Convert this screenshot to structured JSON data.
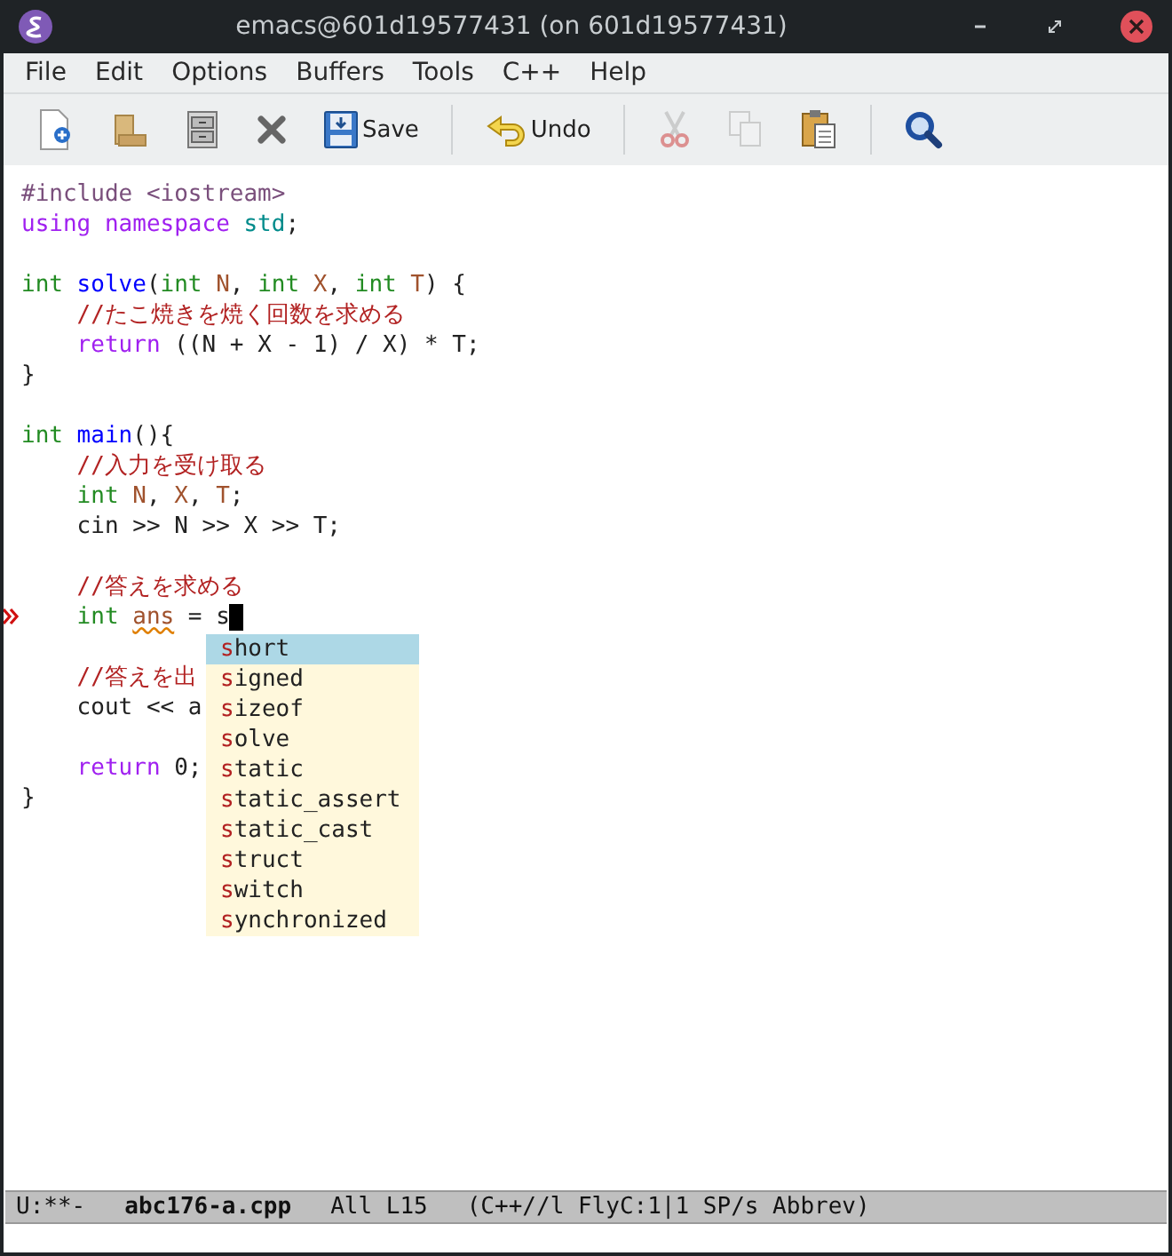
{
  "window": {
    "title": "emacs@601d19577431 (on 601d19577431)"
  },
  "menu": [
    "File",
    "Edit",
    "Options",
    "Buffers",
    "Tools",
    "C++",
    "Help"
  ],
  "toolbar": [
    {
      "kind": "new",
      "disabled": false
    },
    {
      "kind": "open",
      "disabled": false
    },
    {
      "kind": "dired",
      "disabled": false
    },
    {
      "kind": "close",
      "disabled": false
    },
    {
      "kind": "save",
      "label": "Save",
      "disabled": false
    },
    {
      "kind": "separator"
    },
    {
      "kind": "undo",
      "label": "Undo",
      "disabled": false
    },
    {
      "kind": "separator"
    },
    {
      "kind": "cut",
      "disabled": true
    },
    {
      "kind": "copy",
      "disabled": true
    },
    {
      "kind": "paste",
      "disabled": false
    },
    {
      "kind": "separator"
    },
    {
      "kind": "search",
      "disabled": false
    }
  ],
  "code": [
    {
      "tokens": [
        {
          "text": "#include <iostream>",
          "kind": "preprocessor"
        }
      ]
    },
    {
      "tokens": [
        {
          "text": "using namespace",
          "kind": "keyword"
        },
        {
          "text": " std",
          "kind": "constant"
        },
        {
          "text": ";"
        }
      ]
    },
    {
      "kind": "blank"
    },
    {
      "tokens": [
        {
          "text": "int",
          "kind": "type"
        },
        {
          "text": " solve",
          "kind": "function"
        },
        {
          "text": "("
        },
        {
          "text": "int",
          "kind": "type"
        },
        {
          "text": " N",
          "kind": "variable"
        },
        {
          "text": ", "
        },
        {
          "text": "int",
          "kind": "type"
        },
        {
          "text": " X",
          "kind": "variable"
        },
        {
          "text": ", "
        },
        {
          "text": "int",
          "kind": "type"
        },
        {
          "text": " T",
          "kind": "variable"
        },
        {
          "text": ") {"
        }
      ]
    },
    {
      "tokens": [
        {
          "text": "    //たこ焼きを焼く回数を求める",
          "kind": "comment"
        }
      ]
    },
    {
      "tokens": [
        {
          "text": "    return",
          "kind": "keyword"
        },
        {
          "text": " ((N + X - 1) / X) * T;"
        }
      ]
    },
    {
      "tokens": [
        {
          "text": "}"
        }
      ]
    },
    {
      "kind": "blank"
    },
    {
      "tokens": [
        {
          "text": "int",
          "kind": "type"
        },
        {
          "text": " main",
          "kind": "function"
        },
        {
          "text": "(){"
        }
      ]
    },
    {
      "tokens": [
        {
          "text": "    //入力を受け取る",
          "kind": "comment"
        }
      ]
    },
    {
      "tokens": [
        {
          "text": "    int",
          "kind": "type"
        },
        {
          "text": " N",
          "kind": "variable"
        },
        {
          "text": ", "
        },
        {
          "text": "X",
          "kind": "variable"
        },
        {
          "text": ", "
        },
        {
          "text": "T",
          "kind": "variable"
        },
        {
          "text": ";"
        }
      ]
    },
    {
      "tokens": [
        {
          "text": "    cin >> N >> X >> T;"
        }
      ]
    },
    {
      "kind": "blank"
    },
    {
      "tokens": [
        {
          "text": "    //答えを求める",
          "kind": "comment"
        }
      ]
    },
    {
      "error": true,
      "cursor": true,
      "tokens": [
        {
          "text": "    int ",
          "kind": "type"
        },
        {
          "text": "ans",
          "kind": "variable",
          "warning": true
        },
        {
          "text": " = s"
        }
      ]
    },
    {
      "kind": "blank"
    },
    {
      "tokens": [
        {
          "text": "    //答えを出",
          "kind": "comment"
        }
      ]
    },
    {
      "tokens": [
        {
          "text": "    cout << a"
        }
      ]
    },
    {
      "kind": "blank"
    },
    {
      "tokens": [
        {
          "text": "    return",
          "kind": "keyword"
        },
        {
          "text": " 0;"
        }
      ]
    },
    {
      "tokens": [
        {
          "text": "}"
        }
      ]
    }
  ],
  "completion": [
    {
      "label": "short",
      "selected": true
    },
    {
      "label": "signed",
      "selected": false
    },
    {
      "label": "sizeof",
      "selected": false
    },
    {
      "label": "solve",
      "selected": false
    },
    {
      "label": "static",
      "selected": false
    },
    {
      "label": "static_assert",
      "selected": false
    },
    {
      "label": "static_cast",
      "selected": false
    },
    {
      "label": "struct",
      "selected": false
    },
    {
      "label": "switch",
      "selected": false
    },
    {
      "label": "synchronized",
      "selected": false
    }
  ],
  "mode_line": {
    "status": "U:**-",
    "buffer": "abc176-a.cpp",
    "position": "All L15",
    "modes": "(C++//l FlyC:1|1 SP/s Abbrev)"
  }
}
